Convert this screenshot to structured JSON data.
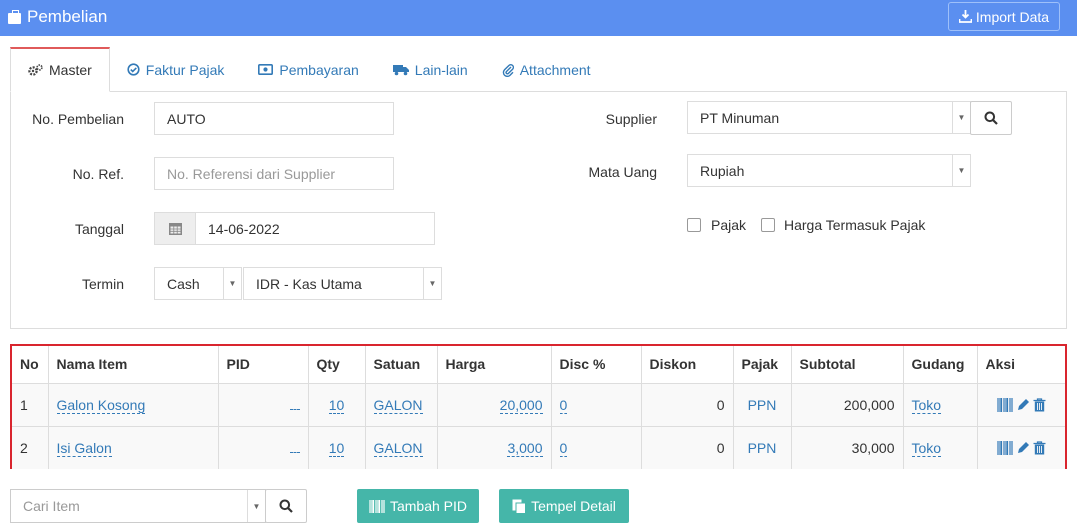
{
  "header": {
    "title": "Pembelian",
    "import_label": "Import Data"
  },
  "tabs": [
    {
      "label": "Master",
      "icon": "gears-icon"
    },
    {
      "label": "Faktur Pajak",
      "icon": "check-circle-icon"
    },
    {
      "label": "Pembayaran",
      "icon": "money-icon"
    },
    {
      "label": "Lain-lain",
      "icon": "truck-icon"
    },
    {
      "label": "Attachment",
      "icon": "paperclip-icon"
    }
  ],
  "form": {
    "no_pembelian_label": "No. Pembelian",
    "no_pembelian_value": "AUTO",
    "no_ref_label": "No. Ref.",
    "no_ref_placeholder": "No. Referensi dari Supplier",
    "tanggal_label": "Tanggal",
    "tanggal_value": "14-06-2022",
    "termin_label": "Termin",
    "termin_value": "Cash",
    "kas_value": "IDR - Kas Utama",
    "supplier_label": "Supplier",
    "supplier_value": "PT Minuman",
    "mata_uang_label": "Mata Uang",
    "mata_uang_value": "Rupiah",
    "pajak_label": "Pajak",
    "harga_termasuk_pajak_label": "Harga Termasuk Pajak"
  },
  "table": {
    "headers": [
      "No",
      "Nama Item",
      "PID",
      "Qty",
      "Satuan",
      "Harga",
      "Disc %",
      "Diskon",
      "Pajak",
      "Subtotal",
      "Gudang",
      "Aksi"
    ],
    "rows": [
      {
        "no": "1",
        "nama": "Galon Kosong",
        "pid": "",
        "qty": "10",
        "satuan": "GALON",
        "harga": "20,000",
        "disc": "0",
        "diskon": "0",
        "pajak": "PPN",
        "subtotal": "200,000",
        "gudang": "Toko"
      },
      {
        "no": "2",
        "nama": "Isi Galon",
        "pid": "",
        "qty": "10",
        "satuan": "GALON",
        "harga": "3,000",
        "disc": "0",
        "diskon": "0",
        "pajak": "PPN",
        "subtotal": "30,000",
        "gudang": "Toko"
      }
    ]
  },
  "bottom": {
    "search_placeholder": "Cari Item",
    "tambah_pid_label": "Tambah PID",
    "tempel_detail_label": "Tempel Detail"
  },
  "colors": {
    "header_bg": "#5b8ff0",
    "link": "#337ab7",
    "accent_red": "#d9252e",
    "teal": "#45b6a9"
  }
}
